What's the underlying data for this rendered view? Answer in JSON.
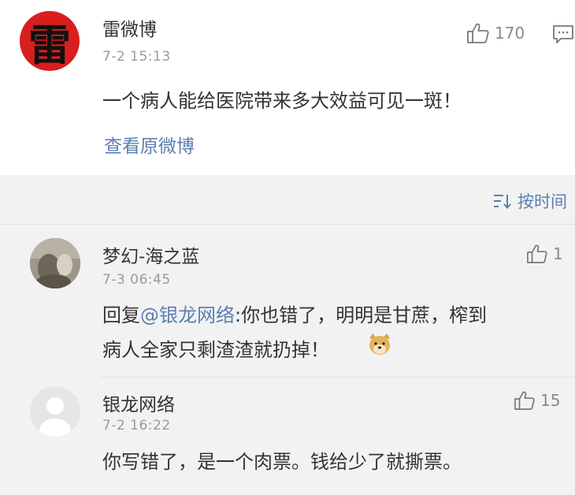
{
  "post": {
    "author": "雷微博",
    "avatar_char": "雷",
    "time": "7-2 15:13",
    "text": "一个病人能给医院带来多大效益可见一斑！",
    "likes": "170",
    "view_original": "查看原微博"
  },
  "sort": {
    "label": "按时间"
  },
  "comments": [
    {
      "author": "梦幻-海之蓝",
      "time": "7-3 06:45",
      "reply_prefix": "回复",
      "mention": "@银龙网络",
      "line1_rest": ":你也错了，明明是甘蔗，榨到",
      "line2": "病人全家只剩渣渣就扔掉！",
      "likes": "1"
    },
    {
      "author": "银龙网络",
      "time": "7-2 16:22",
      "text": "你写错了，是一个肉票。钱给少了就撕票。",
      "likes": "15"
    }
  ],
  "colors": {
    "link": "#5b7fb0",
    "avatar_red": "#d91e1e",
    "meta_gray": "#9a9a9a"
  },
  "icons": {
    "like": "thumbs-up-icon",
    "comment": "comment-icon",
    "sort": "sort-icon",
    "emoji": "doge-emoji-icon"
  }
}
